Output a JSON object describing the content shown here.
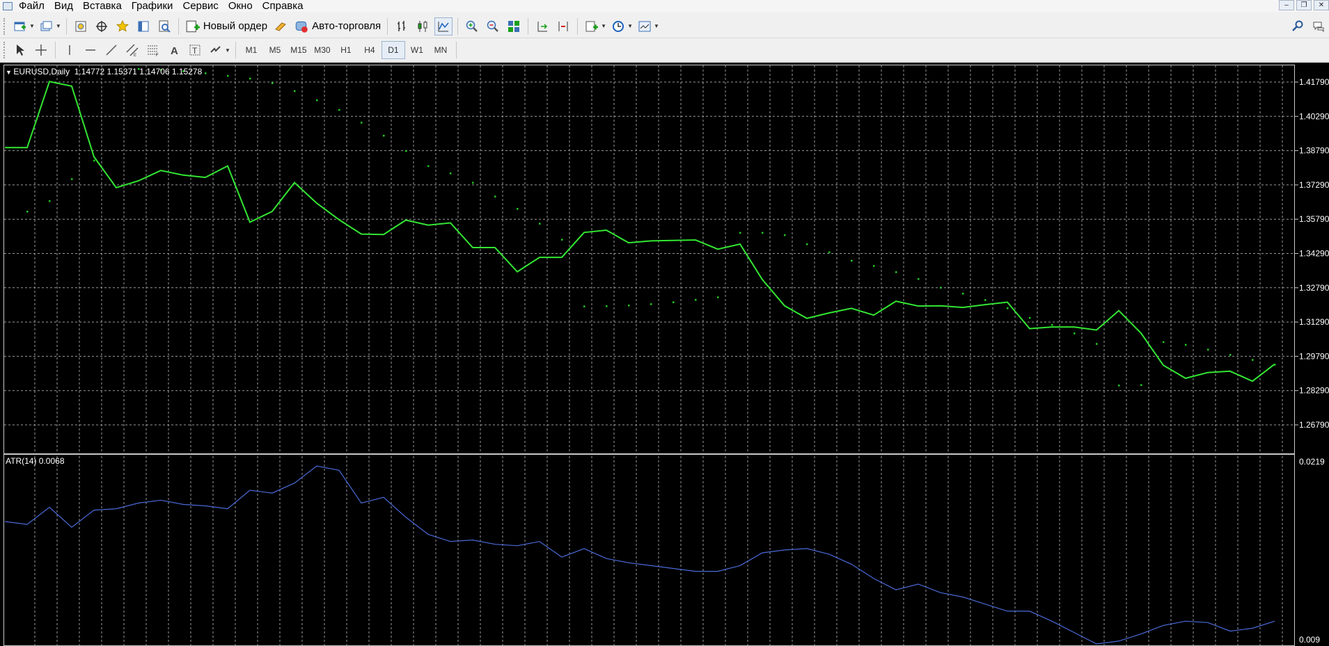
{
  "menu": {
    "items": [
      "Файл",
      "Вид",
      "Вставка",
      "Графики",
      "Сервис",
      "Окно",
      "Справка"
    ]
  },
  "toolbar1": {
    "new_order_label": "Новый ордер",
    "autotrade_label": "Авто-торговля",
    "icons": [
      "new-chart-icon",
      "profiles-icon",
      "market-watch-icon",
      "navigator-icon",
      "favorites-icon",
      "data-window-icon",
      "strategy-tester-icon",
      "new-order-icon",
      "metaeditor-icon",
      "autotrade-icon",
      "bar-chart-icon",
      "candlestick-icon",
      "line-chart-icon",
      "zoom-in-icon",
      "zoom-out-icon",
      "tile-windows-icon",
      "auto-scroll-icon",
      "chart-shift-icon",
      "indicators-icon",
      "periods-icon",
      "templates-icon",
      "search-icon",
      "chat-icon"
    ]
  },
  "toolbar2": {
    "timeframes": [
      "M1",
      "M5",
      "M15",
      "M30",
      "H1",
      "H4",
      "D1",
      "W1",
      "MN"
    ],
    "active_timeframe": "D1",
    "tools": [
      "cursor-icon",
      "crosshair-icon",
      "vertical-line-icon",
      "horizontal-line-icon",
      "trendline-icon",
      "equidistant-channel-icon",
      "fibonacci-icon",
      "text-icon",
      "text-label-icon",
      "arrows-icon"
    ]
  },
  "chart": {
    "header": "EURUSD,Daily  1.14772 1.15371 1.14706 1.15278",
    "atr_header": "ATR(14) 0.0068",
    "colors": {
      "background": "#000000",
      "price_line": "#33e633",
      "sar_dots": "#22cc22",
      "atr_line": "#4a6ad8",
      "grid": "#9a9a9a"
    }
  },
  "chart_data": [
    {
      "type": "line",
      "title": "EURUSD,Daily  1.14772 1.15371 1.14706 1.15278",
      "ylim": [
        1.2629,
        1.4309
      ],
      "yticks": [
        "1.41790",
        "1.40290",
        "1.38790",
        "1.37290",
        "1.35790",
        "1.34290",
        "1.32790",
        "1.31290",
        "1.29790",
        "1.28290",
        "1.26790"
      ],
      "series": [
        {
          "values": [
            1.3892,
            1.3892,
            1.4181,
            1.4161,
            1.3852,
            1.3717,
            1.3747,
            1.3792,
            1.3772,
            1.3762,
            1.3812,
            1.3566,
            1.3613,
            1.3739,
            1.3649,
            1.3577,
            1.3514,
            1.3512,
            1.3575,
            1.3553,
            1.3563,
            1.3455,
            1.3455,
            1.3349,
            1.3412,
            1.3412,
            1.3521,
            1.3531,
            1.3476,
            1.3484,
            1.3486,
            1.3488,
            1.3448,
            1.347,
            1.3315,
            1.32,
            1.3145,
            1.3169,
            1.3189,
            1.3159,
            1.322,
            1.3199,
            1.32,
            1.3193,
            1.3205,
            1.3216,
            1.31,
            1.3107,
            1.3107,
            1.3094,
            1.3179,
            1.308,
            1.294,
            1.2883,
            1.2908,
            1.2914,
            1.287,
            1.2945
          ]
        },
        {
          "values": [
            null,
            1.3613,
            1.3659,
            1.3755,
            1.3836,
            null,
            1.4237,
            1.4233,
            1.4227,
            1.4218,
            1.4207,
            1.4195,
            1.4175,
            1.414,
            1.41,
            1.4058,
            1.4002,
            1.3945,
            1.3878,
            1.3812,
            1.378,
            1.3739,
            1.3679,
            1.3625,
            1.356,
            1.349,
            1.3198,
            1.3199,
            1.3202,
            1.3208,
            1.3216,
            1.3227,
            1.3238,
            1.352,
            1.352,
            1.351,
            1.347,
            1.3435,
            1.3398,
            1.3375,
            1.3348,
            1.3318,
            1.328,
            1.3254,
            1.3226,
            1.319,
            1.3148,
            1.3117,
            1.308,
            1.3034,
            1.2852,
            1.2854,
            1.3042,
            1.303,
            1.3009,
            1.2986,
            1.2964,
            1.2943
          ]
        }
      ]
    },
    {
      "type": "line",
      "title": "ATR(14) 0.0068",
      "ylim": [
        0.009,
        0.0219
      ],
      "yticks": [
        "0.0219",
        "0.009"
      ],
      "series": [
        {
          "values": [
            0.0176,
            0.0174,
            0.0186,
            0.0172,
            0.0184,
            0.0185,
            0.0189,
            0.0191,
            0.0188,
            0.0187,
            0.0185,
            0.0198,
            0.0196,
            0.0203,
            0.0215,
            0.0212,
            0.0189,
            0.0193,
            0.0179,
            0.0167,
            0.0162,
            0.0163,
            0.016,
            0.0159,
            0.0162,
            0.0151,
            0.0157,
            0.015,
            0.0147,
            0.0145,
            0.0143,
            0.0141,
            0.0141,
            0.0145,
            0.0154,
            0.0156,
            0.0157,
            0.0153,
            0.0146,
            0.0136,
            0.0128,
            0.0132,
            0.0126,
            0.0123,
            0.0118,
            0.0113,
            0.0113,
            0.0106,
            0.0098,
            0.009,
            0.0092,
            0.0097,
            0.0103,
            0.0106,
            0.0105,
            0.0099,
            0.0101,
            0.0106
          ]
        }
      ]
    }
  ]
}
